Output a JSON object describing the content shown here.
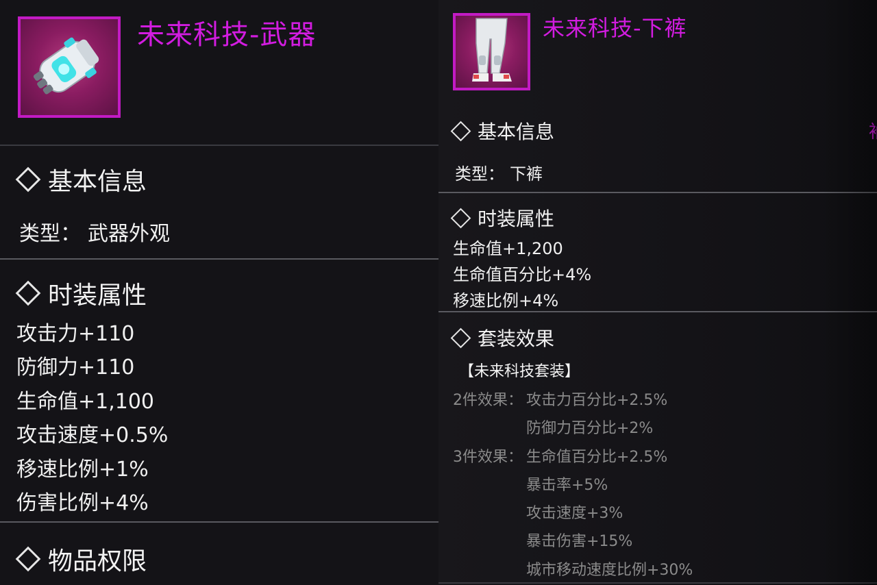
{
  "left": {
    "title": "未来科技-武器",
    "icon": "gauntlet-weapon-icon",
    "basic_info": {
      "header": "基本信息",
      "type_label": "类型：",
      "type_value": "武器外观"
    },
    "attributes": {
      "header": "时装属性",
      "items": [
        "攻击力+110",
        "防御力+110",
        "生命值+1,100",
        "攻击速度+0.5%",
        "移速比例+1%",
        "伤害比例+4%"
      ]
    },
    "permissions": {
      "header": "物品权限"
    }
  },
  "right": {
    "title": "未来科技-下裤",
    "icon": "armored-pants-icon",
    "basic_info": {
      "header": "基本信息",
      "type_label": "类型：",
      "type_value": "下裤"
    },
    "attributes": {
      "header": "时装属性",
      "items": [
        "生命值+1,200",
        "生命值百分比+4%",
        "移速比例+4%"
      ]
    },
    "set_effect": {
      "header": "套装效果",
      "set_name": "【未来科技套装】",
      "tiers": [
        {
          "label": "2件效果：",
          "effects": [
            "攻击力百分比+2.5%",
            "防御力百分比+2%"
          ]
        },
        {
          "label": "3件效果：",
          "effects": [
            "生命值百分比+2.5%",
            "暴击率+5%",
            "攻击速度+3%",
            "暴击伤害+15%",
            "城市移动速度比例+30%"
          ]
        }
      ]
    },
    "edge_text": "袖"
  },
  "colors": {
    "title": "#d21ce0",
    "icon_border": "#c21bc4",
    "icon_bg": "#8e1d66",
    "text": "#f0f0f0",
    "dim_text": "#8b8b8b",
    "divider": "#3a3a40"
  }
}
